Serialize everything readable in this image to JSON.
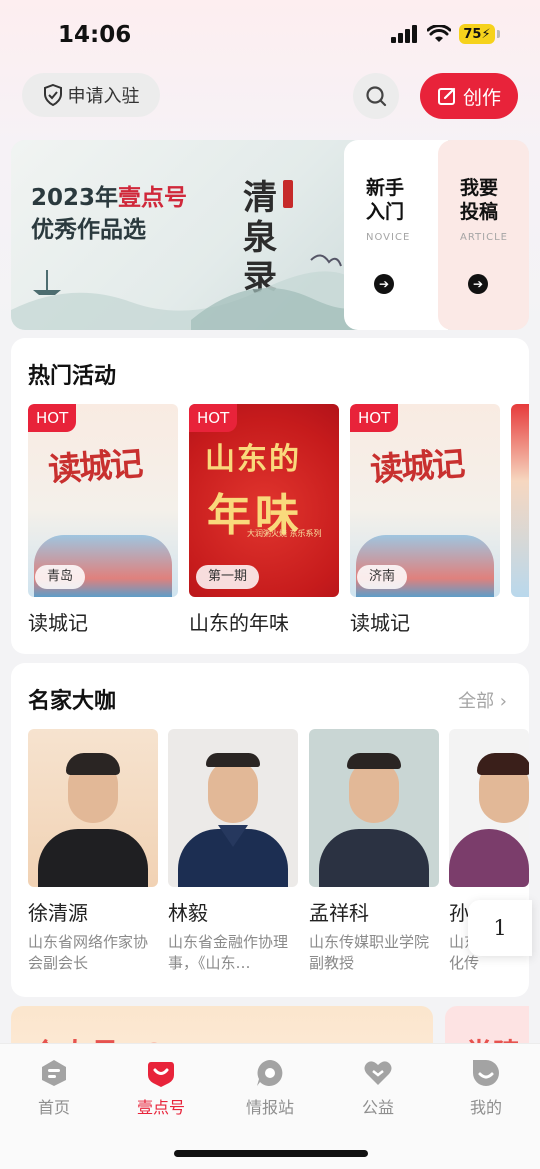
{
  "status_bar": {
    "time": "14:06",
    "battery": "75"
  },
  "header": {
    "apply_label": "申请入驻",
    "create_label": "创作"
  },
  "banner": {
    "year_prefix": "2023年",
    "year_highlight": "壹点号",
    "subtitle": "优秀作品选",
    "calligraphy": "清泉录",
    "cards": [
      {
        "title": "新手\n入门",
        "en": "NOVICE"
      },
      {
        "title": "我要\n投稿",
        "en": "ARTICLE"
      }
    ]
  },
  "activities": {
    "title": "热门活动",
    "hot_badge": "HOT",
    "items": [
      {
        "label": "读城记",
        "tag": "青岛",
        "poster_title": "读城记"
      },
      {
        "label": "山东的年味",
        "tag": "第一期",
        "poster_line1": "山东的",
        "poster_line2": "年味",
        "poster_note": "大润粥火烧 东乐系列"
      },
      {
        "label": "读城记",
        "tag": "济南",
        "poster_title": "读城记"
      }
    ]
  },
  "experts": {
    "title": "名家大咖",
    "more": "全部 ›",
    "items": [
      {
        "name": "徐清源",
        "desc": "山东省网络作家协会副会长"
      },
      {
        "name": "林毅",
        "desc": "山东省金融作协理事，《山东…"
      },
      {
        "name": "孟祥科",
        "desc": "山东传媒职业学院副教授"
      },
      {
        "name": "孙",
        "desc": "山东省院文化传"
      }
    ]
  },
  "float_page": "1",
  "peek": {
    "left_text": "个人号TOP",
    "right_text": "党建"
  },
  "tabbar": {
    "items": [
      {
        "label": "首页",
        "icon": "home-icon",
        "active": false
      },
      {
        "label": "壹点号",
        "icon": "yidian-icon",
        "active": true
      },
      {
        "label": "情报站",
        "icon": "intel-icon",
        "active": false
      },
      {
        "label": "公益",
        "icon": "heart-icon",
        "active": false
      },
      {
        "label": "我的",
        "icon": "profile-icon",
        "active": false
      }
    ]
  },
  "colors": {
    "accent": "#e8233a",
    "bg": "#f3f3f5"
  }
}
